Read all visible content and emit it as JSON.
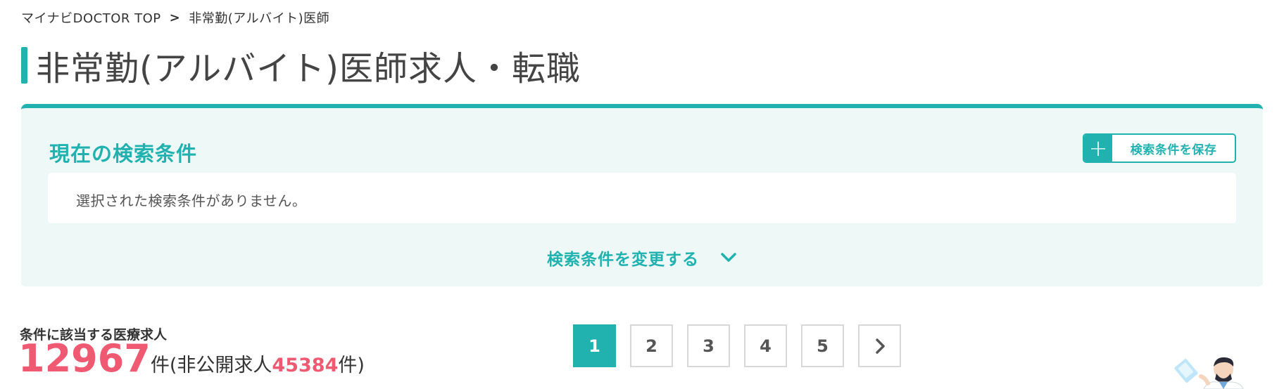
{
  "breadcrumb": {
    "home": "マイナビDOCTOR TOP",
    "separator": ">",
    "current": "非常勤(アルバイト)医師"
  },
  "page_title": "非常勤(アルバイト)医師求人・転職",
  "search_conditions": {
    "title": "現在の検索条件",
    "save_button": "検索条件を保存",
    "empty_message": "選択された検索条件がありません。",
    "change_link": "検索条件を変更する"
  },
  "results": {
    "label": "条件に該当する医療求人",
    "count": "12967",
    "unit": "件",
    "private_open": "(非公開求人",
    "private_count": "45384",
    "private_close": "件)"
  },
  "pagination": {
    "current": 1,
    "pages": [
      "1",
      "2",
      "3",
      "4",
      "5"
    ]
  },
  "colors": {
    "accent": "#21b2b0",
    "panel_bg": "#edf8f7",
    "highlight": "#ef5a72"
  }
}
